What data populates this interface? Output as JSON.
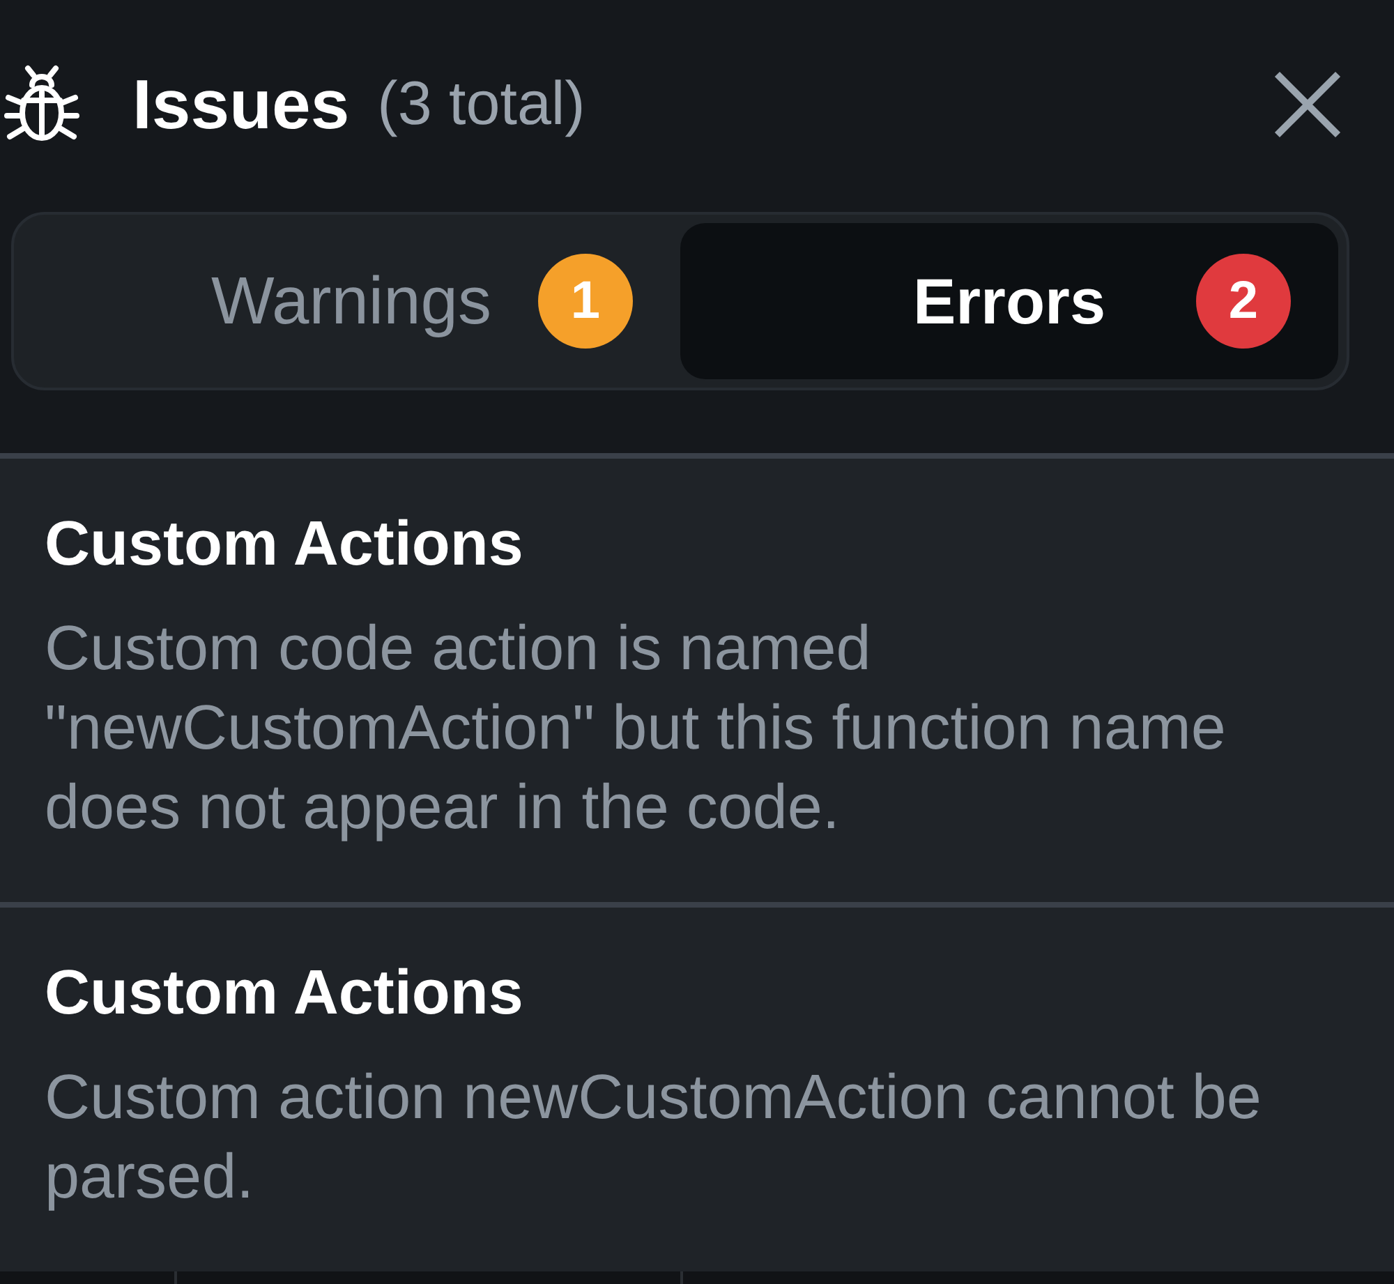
{
  "panel": {
    "title": "Issues",
    "count": "(3 total)"
  },
  "tabs": [
    {
      "label": "Warnings",
      "count": "1",
      "color": "#f5a02a",
      "selected": false
    },
    {
      "label": "Errors",
      "count": "2",
      "color": "#e03a3e",
      "selected": true
    }
  ],
  "issues": [
    {
      "title": "Custom Actions",
      "message": "Custom code action is named \"newCustomAction\" but this function name does not appear in the code."
    },
    {
      "title": "Custom Actions",
      "message": "Custom action newCustomAction cannot be parsed."
    }
  ]
}
